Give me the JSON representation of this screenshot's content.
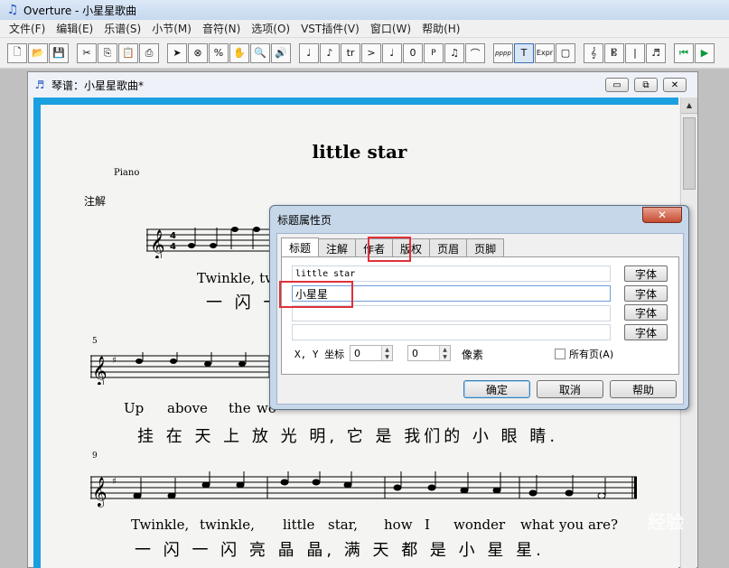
{
  "window": {
    "title": "Overture - 小星星歌曲"
  },
  "menu": [
    "文件(F)",
    "编辑(E)",
    "乐谱(S)",
    "小节(M)",
    "音符(N)",
    "选项(O)",
    "VST插件(V)",
    "窗口(W)",
    "帮助(H)"
  ],
  "toolbar": {
    "buttons": [
      "new-icon",
      "open-icon",
      "save-icon",
      "cut-icon",
      "copy-icon",
      "paste-icon",
      "print-icon",
      "select-icon",
      "erase-icon",
      "percent-icon",
      "hand-icon",
      "zoom-icon",
      "speaker-icon",
      "quarter-note-icon",
      "eighth-note-icon",
      "trill-icon",
      "accent-icon",
      "note-icon",
      "zero-icon",
      "p-icon",
      "beamed-note-icon",
      "slur-icon",
      "pppp-icon",
      "text-icon",
      "expr-icon",
      "box-icon",
      "treble-clef-icon",
      "tenor-clef-icon",
      "bar-line-icon",
      "notes-icon",
      "prev-icon",
      "play-icon"
    ],
    "labels": {
      "zero": "0",
      "p": "P",
      "pppp": "pppp",
      "text": "T",
      "expr": "Expr",
      "percent": "%",
      "trill": "tr",
      "accent": ">"
    }
  },
  "document": {
    "title": "琴谱：小星星歌曲*",
    "win_min": "▭",
    "win_restore": "⧉",
    "win_close": "✕"
  },
  "score": {
    "title": "little star",
    "instrument": "Piano",
    "annotation": "注解",
    "time_signature": "4/4",
    "measure_numbers": [
      "5",
      "9"
    ],
    "line1_lyrics_en": "Twinkle, tw",
    "line1_lyrics_cn": "一 闪 一",
    "line2_lyrics_en": [
      "Up",
      "above",
      "the",
      "wo"
    ],
    "line2_lyrics_cn": "挂 在 天 上   放 光 明,   它 是   我们的   小 眼 睛.",
    "line3_lyrics_en": [
      "Twinkle,",
      "twinkle,",
      "little",
      "star,",
      "how",
      "I",
      "wonder",
      "what",
      "you",
      "are?"
    ],
    "line3_lyrics_cn": "一 闪  一 闪  亮 晶 晶,   满  天  都 是  小 星 星."
  },
  "dialog": {
    "title": "标题属性页",
    "close": "✕",
    "tabs": [
      "标题",
      "注解",
      "作者",
      "版权",
      "页眉",
      "页脚"
    ],
    "active_tab": "标题",
    "fields": [
      "little star",
      "小星星",
      "",
      ""
    ],
    "font_button": "字体",
    "coord_label": "X, Y 坐标",
    "x_value": "0",
    "y_value": "0",
    "pixel_label": "像素",
    "all_pages_label": "所有页(A)",
    "all_pages_checked": false,
    "ok": "确定",
    "cancel": "取消",
    "help": "帮助"
  },
  "watermark": "经验",
  "colors": {
    "score_frame": "#1aa0e0",
    "highlight": "#e0303a"
  }
}
